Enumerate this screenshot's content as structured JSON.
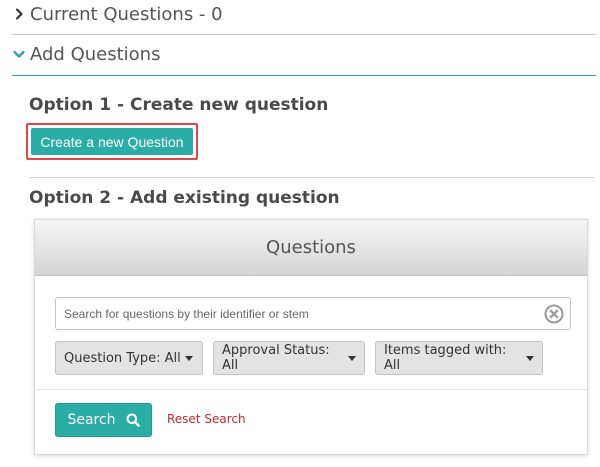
{
  "accordion": {
    "current_label": "Current Questions - 0",
    "add_label": "Add Questions"
  },
  "option1": {
    "title": "Option 1 - Create new question",
    "button_label": "Create a new Question"
  },
  "option2": {
    "title": "Option 2 - Add existing question"
  },
  "questions_panel": {
    "title": "Questions",
    "search_placeholder": "Search for questions by their identifier or stem",
    "search_value": "",
    "filters": {
      "question_type": "Question Type: All",
      "approval_status": "Approval Status: All",
      "items_tagged": "Items tagged with: All"
    },
    "search_button_label": "Search",
    "reset_label": "Reset Search"
  },
  "colors": {
    "accent_teal": "#2aada6",
    "highlight_red": "#e04848",
    "reset_link_red": "#c62828"
  },
  "icons": {
    "collapsed": "chevron-right-icon",
    "expanded": "chevron-down-icon",
    "clear": "clear-circle-x-icon",
    "search": "magnifier-icon"
  }
}
